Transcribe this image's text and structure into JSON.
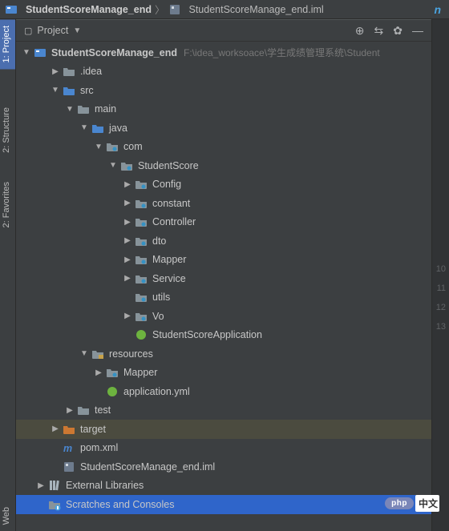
{
  "breadcrumb": {
    "project": "StudentScoreManage_end",
    "file": "StudentScoreManage_end.iml"
  },
  "left_strip": {
    "tabs": [
      "1: Project",
      "2: Structure",
      "2: Favorites",
      "Web"
    ]
  },
  "panel_header": {
    "title": "Project",
    "icons": {
      "target": "⊕",
      "collapse": "⇆",
      "gear": "✿",
      "minimize": "—"
    }
  },
  "right_edge_glyph": "n",
  "tree": {
    "root": {
      "label": "StudentScoreManage_end",
      "path": "F:\\idea_worksoace\\学生成绩管理系统\\Student"
    },
    "nodes": [
      {
        "d": 1,
        "arr": "r",
        "ico": "folder-grey",
        "txt": ".idea"
      },
      {
        "d": 1,
        "arr": "d",
        "ico": "folder-blue",
        "txt": "src"
      },
      {
        "d": 2,
        "arr": "d",
        "ico": "folder-grey",
        "txt": "main"
      },
      {
        "d": 3,
        "arr": "d",
        "ico": "folder-blue",
        "txt": "java"
      },
      {
        "d": 4,
        "arr": "d",
        "ico": "package",
        "txt": "com"
      },
      {
        "d": 5,
        "arr": "d",
        "ico": "package",
        "txt": "StudentScore"
      },
      {
        "d": 6,
        "arr": "r",
        "ico": "package",
        "txt": "Config"
      },
      {
        "d": 6,
        "arr": "r",
        "ico": "package",
        "txt": "constant"
      },
      {
        "d": 6,
        "arr": "r",
        "ico": "package",
        "txt": "Controller"
      },
      {
        "d": 6,
        "arr": "r",
        "ico": "package",
        "txt": "dto"
      },
      {
        "d": 6,
        "arr": "r",
        "ico": "package",
        "txt": "Mapper"
      },
      {
        "d": 6,
        "arr": "r",
        "ico": "package",
        "txt": "Service"
      },
      {
        "d": 6,
        "arr": "",
        "ico": "package",
        "txt": "utils"
      },
      {
        "d": 6,
        "arr": "r",
        "ico": "package",
        "txt": "Vo"
      },
      {
        "d": 6,
        "arr": "",
        "ico": "spring",
        "txt": "StudentScoreApplication"
      },
      {
        "d": 3,
        "arr": "d",
        "ico": "resources",
        "txt": "resources"
      },
      {
        "d": 4,
        "arr": "r",
        "ico": "package",
        "txt": "Mapper"
      },
      {
        "d": 4,
        "arr": "",
        "ico": "spring",
        "txt": "application.yml"
      },
      {
        "d": 2,
        "arr": "r",
        "ico": "folder-grey",
        "txt": "test"
      },
      {
        "d": 1,
        "arr": "r",
        "ico": "folder-orange",
        "txt": "target",
        "sel": "selected"
      },
      {
        "d": 1,
        "arr": "",
        "ico": "maven",
        "txt": "pom.xml"
      },
      {
        "d": 1,
        "arr": "",
        "ico": "module-file",
        "txt": "StudentScoreManage_end.iml"
      },
      {
        "d": 0,
        "arr": "r",
        "ico": "library",
        "txt": "External Libraries"
      },
      {
        "d": 0,
        "arr": "",
        "ico": "scratch",
        "txt": "Scratches and Consoles",
        "sel": "selected-blue"
      }
    ]
  },
  "gutter_lines": [
    "10",
    "11",
    "12",
    "13"
  ],
  "badge": {
    "php": "php",
    "cn": "中文"
  }
}
